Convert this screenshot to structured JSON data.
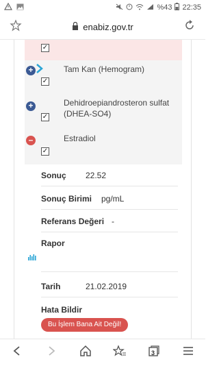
{
  "status_bar": {
    "battery": "%43",
    "time": "22:35"
  },
  "browser": {
    "url": "enabiz.gov.tr",
    "tabs_count": "3"
  },
  "tests": [
    {
      "label": "Tam Kan (Hemogram)",
      "state": "collapsed"
    },
    {
      "label": "Dehidroepiandrosteron sulfat (DHEA-SO4)",
      "state": "collapsed"
    },
    {
      "label": "Estradiol",
      "state": "expanded"
    }
  ],
  "details": {
    "sonuc_label": "Sonuç",
    "sonuc_value": "22.52",
    "birim_label": "Sonuç Birimi",
    "birim_value": "pg/mL",
    "referans_label": "Referans Değeri",
    "referans_value": "-",
    "rapor_label": "Rapor",
    "tarih_label": "Tarih",
    "tarih_value": "21.02.2019",
    "hata_label": "Hata Bildir",
    "hata_button": "Bu İşlem Bana Ait Değil!"
  },
  "colors": {
    "expand_blue": "#3b5a94",
    "collapse_red": "#d9534f",
    "accent_cyan": "#2aa5d6"
  }
}
